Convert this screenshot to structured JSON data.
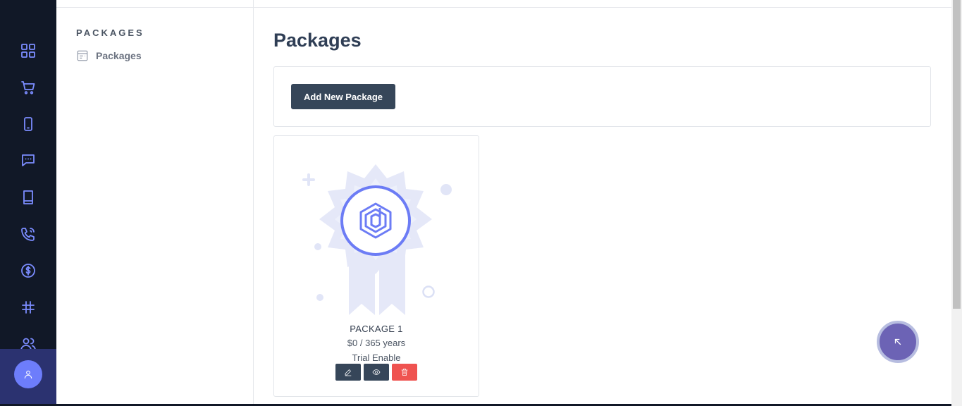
{
  "rail": {
    "icons": [
      "dashboard-icon",
      "cart-icon",
      "mobile-icon",
      "chat-icon",
      "book-icon",
      "phone-call-icon",
      "dollar-icon",
      "hashtag-icon",
      "users-icon"
    ],
    "avatar_icon": "user-icon"
  },
  "subnav": {
    "heading": "PACKAGES",
    "items": [
      {
        "label": "Packages",
        "icon": "list-icon"
      }
    ]
  },
  "main": {
    "title": "Packages",
    "add_button_label": "Add New Package",
    "packages": [
      {
        "name": "PACKAGE 1",
        "price": "$0 / 365 years",
        "status": "Trial Enable",
        "actions": [
          "edit-icon",
          "view-icon",
          "delete-icon"
        ]
      }
    ]
  },
  "fab": {
    "icon": "arrow-up-left-icon"
  },
  "colors": {
    "rail_bg": "#111827",
    "accent": "#7b8cff",
    "button_dark": "#364659",
    "button_red": "#ef5350",
    "title_text": "#2f3e55"
  }
}
